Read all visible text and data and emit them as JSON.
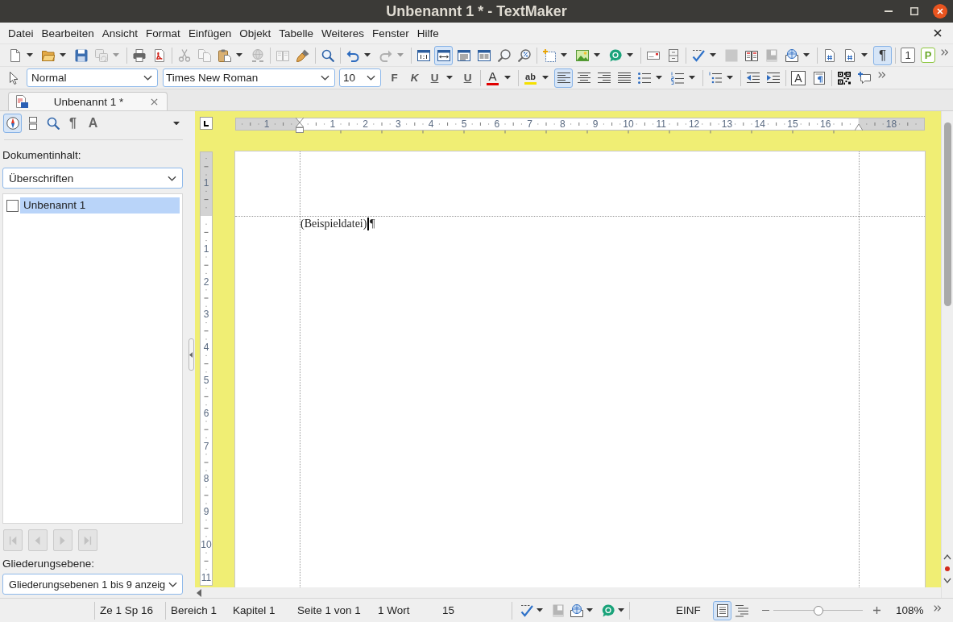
{
  "window": {
    "title": "Unbenannt 1 * - TextMaker"
  },
  "menu_bar": {
    "items": [
      "Datei",
      "Bearbeiten",
      "Ansicht",
      "Format",
      "Einfügen",
      "Objekt",
      "Tabelle",
      "Weiteres",
      "Fenster",
      "Hilfe"
    ]
  },
  "standard_toolbar": {
    "save_copies": {
      "disabled": true
    },
    "cut": {
      "disabled": true
    },
    "copy": {
      "disabled": true
    },
    "link": {
      "disabled": true
    },
    "book": {
      "disabled": true
    },
    "redo": {
      "disabled": true
    },
    "view_modes": [
      {
        "selected": false
      },
      {
        "selected": true
      },
      {
        "selected": false
      },
      {
        "selected": false
      }
    ],
    "shading": {
      "disabled": true
    },
    "database": {
      "disabled": true
    },
    "formatting_marks": {
      "label": "¶",
      "selected": true
    },
    "number_button": {
      "label": "1"
    },
    "letter_button": {
      "label": "P"
    }
  },
  "formatting_toolbar": {
    "style": {
      "value": "Normal"
    },
    "font": {
      "value": "Times New Roman"
    },
    "size": {
      "value": "10"
    },
    "bold": {
      "label": "F",
      "selected": false
    },
    "italic": {
      "label": "K",
      "selected": false
    },
    "underline": {
      "label": "U",
      "selected": false
    },
    "underline_words": {
      "label": "U",
      "selected": false
    },
    "font_color": {
      "label": "A"
    },
    "highlight": {
      "label": "ab"
    },
    "alignment": [
      {
        "selected": true
      },
      {
        "selected": false
      },
      {
        "selected": false
      },
      {
        "selected": false
      }
    ],
    "text_frame": {
      "label": "A"
    }
  },
  "document_tabs": [
    {
      "title": "Unbenannt 1 *",
      "selected": true
    }
  ],
  "navigator": {
    "tabs": [
      {
        "kind": "icon",
        "selected": true
      },
      {
        "kind": "icon",
        "selected": false
      },
      {
        "kind": "icon",
        "selected": false
      },
      {
        "kind": "glyph",
        "label": "¶",
        "selected": false
      },
      {
        "kind": "glyph",
        "label": "A",
        "selected": false
      }
    ],
    "content_label": "Dokumentinhalt:",
    "content_select": {
      "value": "Überschriften"
    },
    "outline": [
      {
        "label": "Unbenannt 1",
        "checked": false,
        "selected": true
      }
    ],
    "browse_buttons": [
      {
        "disabled": true
      },
      {
        "disabled": true
      },
      {
        "disabled": true
      },
      {
        "disabled": true
      }
    ],
    "level_label": "Gliederungsebene:",
    "level_select": {
      "value": "Gliederungsebenen 1 bis 9 anzeig"
    }
  },
  "document": {
    "horizontal_ruler": {
      "left_margin_labels": [
        "1"
      ],
      "labels": [
        "1",
        "2",
        "3",
        "4",
        "5",
        "6",
        "7",
        "8",
        "9",
        "10",
        "11",
        "12",
        "13",
        "14",
        "15",
        "16"
      ],
      "right_margin_labels": [
        "18"
      ]
    },
    "vertical_ruler": {
      "top_margin_labels": [
        "1"
      ],
      "labels": [
        "1",
        "2",
        "3",
        "4",
        "5",
        "6",
        "7",
        "8",
        "9",
        "10",
        "11"
      ]
    },
    "paragraphs": [
      {
        "text": "(Beispieldatei)",
        "cursor": true
      }
    ],
    "paragraph_mark": "¶"
  },
  "status_bar": {
    "cells": [
      "Ze 1 Sp 16",
      "Bereich 1",
      "Kapitel 1",
      "Seite 1 von 1",
      "1 Wort",
      "15"
    ],
    "database": {
      "disabled": true
    },
    "mode": "EINF",
    "view_modes": [
      {
        "selected": true
      },
      {
        "selected": false
      }
    ],
    "zoom": {
      "level": 0.5,
      "reading": "108%"
    }
  }
}
